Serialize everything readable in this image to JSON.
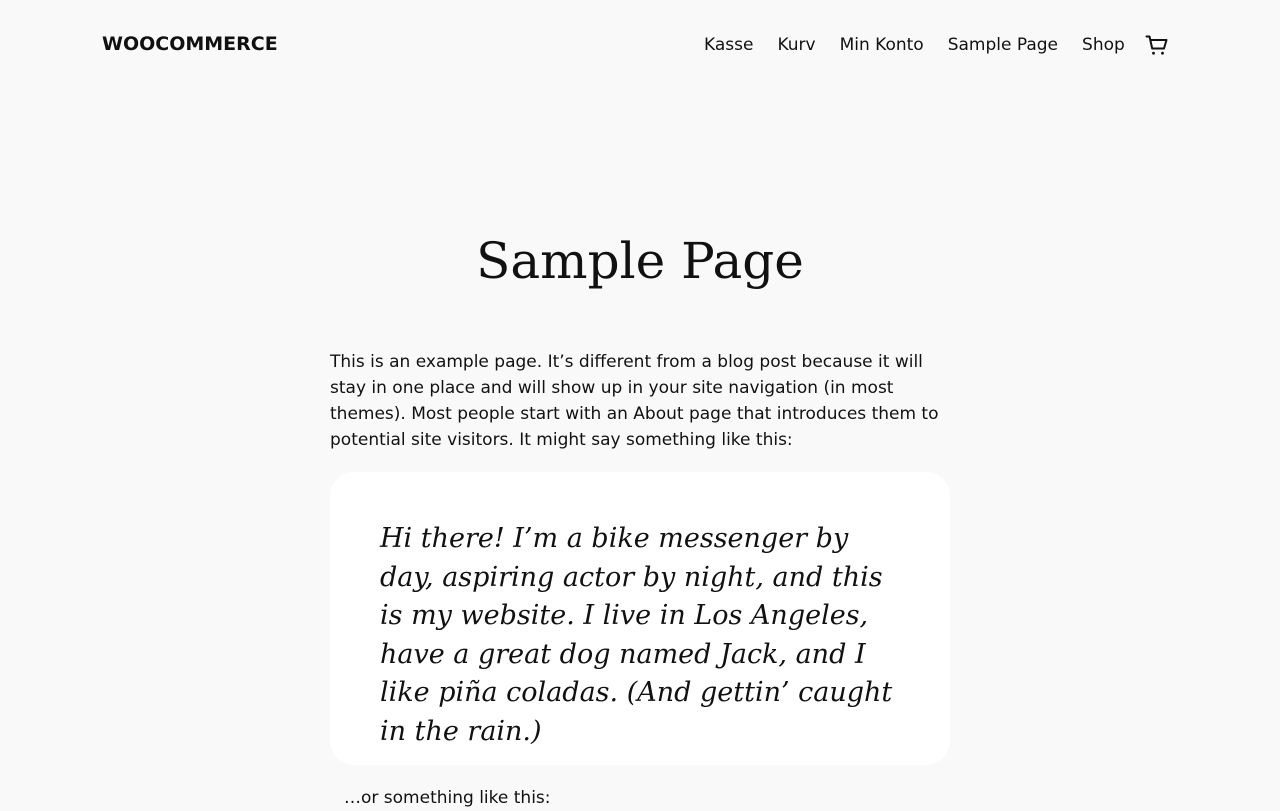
{
  "header": {
    "site_title": "WOOCOMMERCE",
    "nav": [
      {
        "label": "Kasse"
      },
      {
        "label": "Kurv"
      },
      {
        "label": "Min Konto"
      },
      {
        "label": "Sample Page"
      },
      {
        "label": "Shop"
      }
    ],
    "cart_icon": "cart-icon"
  },
  "main": {
    "title": "Sample Page",
    "intro": "This is an example page. It’s different from a blog post because it will stay in one place and will show up in your site navigation (in most themes). Most people start with an About page that introduces them to potential site visitors. It might say something like this:",
    "quote": "Hi there! I’m a bike messenger by day, aspiring actor by night, and this is my website. I live in Los Angeles, have a great dog named Jack, and I like piña coladas. (And gettin’ caught in the rain.)",
    "outro": "…or something like this:"
  },
  "colors": {
    "background": "#f9f9f9",
    "text": "#111111",
    "quote_background": "#ffffff"
  }
}
